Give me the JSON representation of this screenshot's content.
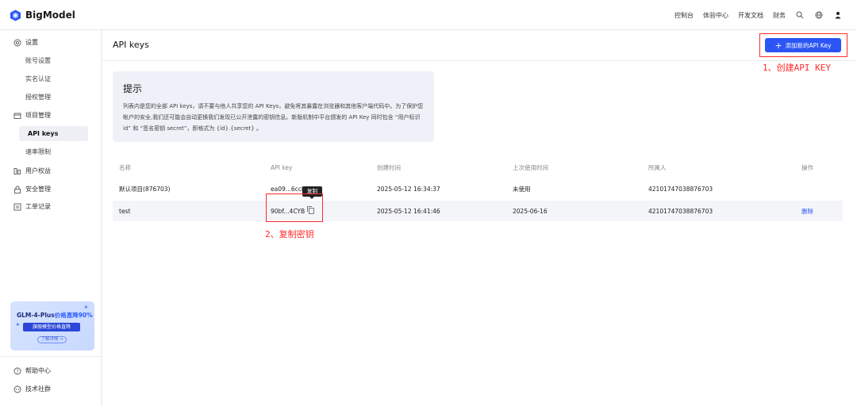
{
  "header": {
    "logo_text": "BigModel",
    "nav": [
      "控制台",
      "体验中心",
      "开发文档",
      "财务"
    ],
    "icons": [
      "search-icon",
      "globe-icon",
      "user-icon"
    ],
    "brand_color": "#2b55f5"
  },
  "sidebar": {
    "settings_label": "设置",
    "settings_items": [
      "账号设置",
      "实名认证",
      "授权管理"
    ],
    "project_label": "项目管理",
    "project_items": [
      "API keys",
      "速率限制"
    ],
    "rights_label": "用户权益",
    "security_label": "安全管理",
    "ticket_label": "工单记录",
    "promo": {
      "title_prefix": "GLM-4-Plus",
      "title_highlight": "价格直降90%",
      "pill": "旗舰模型价格直降",
      "button": "了解详情 →"
    },
    "help_label": "帮助中心",
    "community_label": "技术社群"
  },
  "main": {
    "title": "API keys",
    "add_button": "添加新的API Key",
    "annotation_1": "1、创建API KEY",
    "annotation_2": "2、复制密钥",
    "tip": {
      "title": "提示",
      "body": "列表内是您的全部 API keys，请不要与他人共享您的 API Keys，避免将其暴露在浏览器和其他客户端代码中。为了保护您帐户的安全,我们还可能会自动更换我们发现已公开泄露的密钥信息。新版机制中平台颁发的 API Key 同时包含 “用户标识 id” 和 “签名密钥 secret”，即格式为 {id}.{secret} 。"
    },
    "table": {
      "headers": [
        "名称",
        "API key",
        "创建时间",
        "上次使用时间",
        "所属人",
        "操作"
      ],
      "rows": [
        {
          "name": "默认项目(876703)",
          "key": "ea09...6ccl",
          "created": "2025-05-12 16:34:37",
          "last_used": "未使用",
          "owner": "42101747038876703",
          "action": ""
        },
        {
          "name": "test",
          "key": "90bf...4CYB",
          "created": "2025-05-12 16:41:46",
          "last_used": "2025-06-16",
          "owner": "42101747038876703",
          "action": "删除"
        }
      ]
    },
    "tooltip": "复制"
  }
}
